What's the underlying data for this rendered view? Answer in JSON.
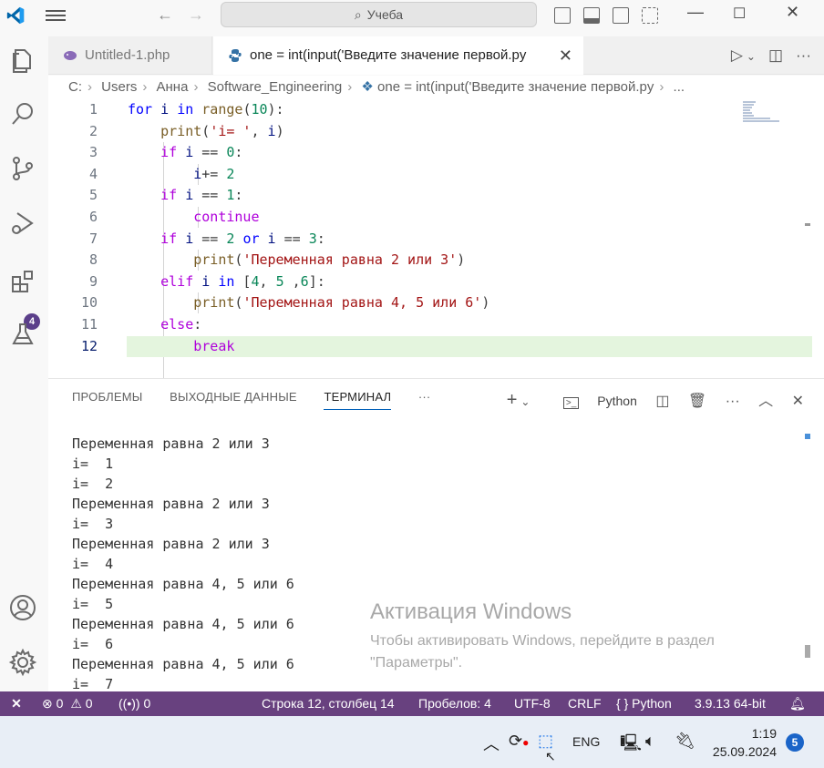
{
  "titlebar": {
    "search_label": "Учеба",
    "icons": [
      "vscode-logo-icon",
      "menu-icon",
      "back-arrow-icon",
      "forward-arrow-icon",
      "search-icon",
      "toggle-sidebar-icon",
      "toggle-panel-icon",
      "toggle-secondary-sidebar-icon",
      "customize-layout-icon",
      "minimize-icon",
      "maximize-icon",
      "close-icon"
    ]
  },
  "activity_bar": {
    "items": [
      "explorer-icon",
      "search-icon",
      "source-control-icon",
      "run-debug-icon",
      "extensions-icon",
      "testing-icon",
      "accounts-icon",
      "settings-gear-icon"
    ],
    "extensions_badge": "4"
  },
  "tabs": [
    {
      "label": "Untitled-1.php",
      "active": false
    },
    {
      "label": "one = int(input('Введите значение первой.py",
      "active": true
    }
  ],
  "breadcrumb": [
    "C:",
    "Users",
    "Анна",
    "Software_Engineering",
    "one = int(input('Введите значение первой.py",
    "..."
  ],
  "editor": {
    "active_line": 12,
    "line_numbers": [
      "1",
      "2",
      "3",
      "4",
      "5",
      "6",
      "7",
      "8",
      "9",
      "10",
      "11",
      "12"
    ]
  },
  "panel": {
    "tabs": [
      "ПРОБЛЕМЫ",
      "ВЫХОДНЫЕ ДАННЫЕ",
      "ТЕРМИНАЛ",
      "···"
    ],
    "active_tab": "ТЕРМИНАЛ",
    "terminal_name": "Python",
    "terminal_output": "Переменная равна 2 или 3\ni=  1\ni=  2\nПеременная равна 2 или 3\ni=  3\nПеременная равна 2 или 3\ni=  4\nПеременная равна 4, 5 или 6\ni=  5\nПеременная равна 4, 5 или 6\ni=  6\nПеременная равна 4, 5 или 6\ni=  7"
  },
  "watermark": {
    "title": "Активация Windows",
    "line1": "Чтобы активировать Windows, перейдите в раздел",
    "line2": "\"Параметры\"."
  },
  "statusbar": {
    "remote": "✕",
    "errors": "0",
    "warnings": "0",
    "ports": "0",
    "position": "Строка 12, столбец 14",
    "spaces": "Пробелов: 4",
    "encoding": "UTF-8",
    "eol": "CRLF",
    "language": "Python",
    "interpreter": "3.9.13 64-bit",
    "color": "#68417f"
  },
  "taskbar": {
    "language": "ENG",
    "time": "1:19",
    "date": "25.09.2024",
    "notifications": "5"
  }
}
